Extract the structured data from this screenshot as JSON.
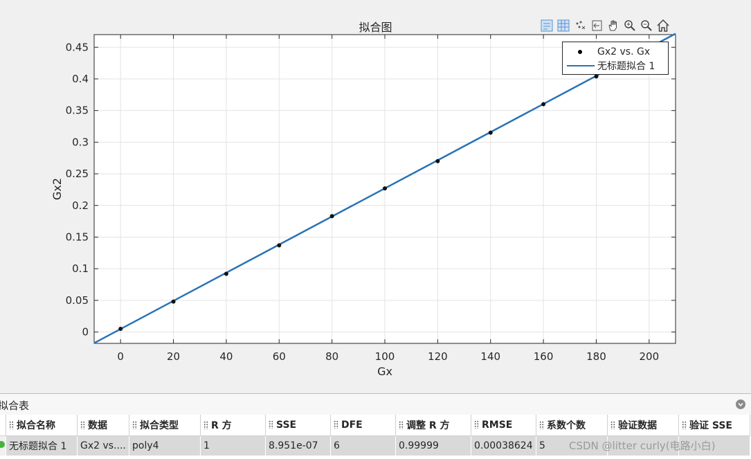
{
  "figure": {
    "title": "拟合图",
    "toolbar": [
      {
        "name": "legend-toggle-icon"
      },
      {
        "name": "grid-toggle-icon"
      },
      {
        "name": "data-cursor-icon"
      },
      {
        "name": "exclude-outliers-icon"
      },
      {
        "name": "pan-icon"
      },
      {
        "name": "zoom-in-icon"
      },
      {
        "name": "zoom-out-icon"
      },
      {
        "name": "home-icon"
      }
    ]
  },
  "chart_data": {
    "type": "scatter",
    "xlabel": "Gx",
    "ylabel": "Gx2",
    "xlim": [
      -10,
      210
    ],
    "ylim": [
      -0.018,
      0.47
    ],
    "xticks": [
      "0",
      "20",
      "40",
      "60",
      "80",
      "100",
      "120",
      "140",
      "160",
      "180",
      "200"
    ],
    "yticks": [
      "0",
      "0.05",
      "0.1",
      "0.15",
      "0.2",
      "0.25",
      "0.3",
      "0.35",
      "0.4",
      "0.45"
    ],
    "grid": true,
    "legend_position": "top-right",
    "series": [
      {
        "name": "Gx2 vs. Gx",
        "type": "scatter",
        "color": "#000000",
        "x": [
          0,
          20,
          40,
          60,
          80,
          100,
          120,
          140,
          160,
          180
        ],
        "y": [
          0.005,
          0.048,
          0.092,
          0.137,
          0.183,
          0.227,
          0.27,
          0.315,
          0.36,
          0.404
        ]
      },
      {
        "name": "无标题拟合 1",
        "type": "line",
        "color": "#2a72b5",
        "x": [
          -10,
          210
        ],
        "y": [
          -0.0175,
          0.4715
        ]
      }
    ]
  },
  "fit_table": {
    "title": "拟合表",
    "columns": [
      "拟合名称",
      "数据",
      "拟合类型",
      "R 方",
      "SSE",
      "DFE",
      "调整 R 方",
      "RMSE",
      "系数个数",
      "验证数据",
      "验证 SSE"
    ],
    "rows": [
      {
        "status_color": "#46b43c",
        "cells": [
          "无标题拟合 1",
          "Gx2 vs....",
          "poly4",
          "1",
          "8.951e-07",
          "6",
          "0.99999",
          "0.00038624",
          "5",
          "",
          ""
        ]
      }
    ]
  },
  "watermark": "CSDN @litter curly(电路小白)"
}
